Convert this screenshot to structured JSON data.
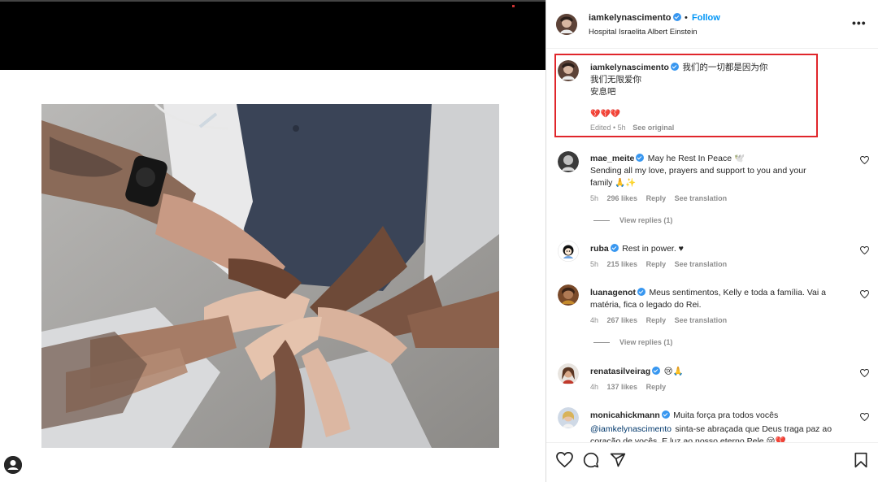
{
  "post": {
    "username": "iamkelynascimento",
    "follow_label": "Follow",
    "dot": "•",
    "location": "Hospital Israelita Albert Einstein",
    "more_label": "•••"
  },
  "caption": {
    "username": "iamkelynascimento",
    "line1": "我们的一切都是因为你",
    "line2": "我们无限爱你",
    "line3": "安息吧",
    "emojis": "💔💔💔",
    "edited": "Edited • 5h",
    "see_original": "See original"
  },
  "comments": [
    {
      "username": "mae_meite",
      "verified": true,
      "text": "May he Rest In Peace 🕊️",
      "text2": "Sending all my love, prayers and support to you and your",
      "text3": "family 🙏✨",
      "time": "5h",
      "likes": "296 likes",
      "reply": "Reply",
      "translate": "See translation",
      "replies": "View replies (1)"
    },
    {
      "username": "ruba",
      "verified": true,
      "text": "Rest in power. ♥",
      "time": "5h",
      "likes": "215 likes",
      "reply": "Reply",
      "translate": "See translation"
    },
    {
      "username": "luanagenot",
      "verified": true,
      "text": "Meus sentimentos, Kelly e toda a família. Vai a",
      "text2": "matéria, fica o legado do Rei.",
      "time": "4h",
      "likes": "267 likes",
      "reply": "Reply",
      "translate": "See translation",
      "replies": "View replies (1)"
    },
    {
      "username": "renatasilveirag",
      "verified": true,
      "text": "😢🙏",
      "time": "4h",
      "likes": "137 likes",
      "reply": "Reply"
    },
    {
      "username": "monicahickmann",
      "verified": true,
      "text": "Muita força pra todos vocês",
      "mention": "@iamkelynascimento",
      "text2": "sinta-se abraçada que Deus traga paz ao",
      "text3": "coração de vocês. E luz ao nosso eterno Pele 😢💔"
    }
  ],
  "icons": {
    "like": "heart-icon",
    "comment": "comment-icon",
    "share": "send-icon",
    "save": "bookmark-icon"
  },
  "colors": {
    "accent": "#0095f6",
    "verified": "#3897f0",
    "highlight_box": "#e0262b",
    "muted": "#8e8e8e"
  }
}
